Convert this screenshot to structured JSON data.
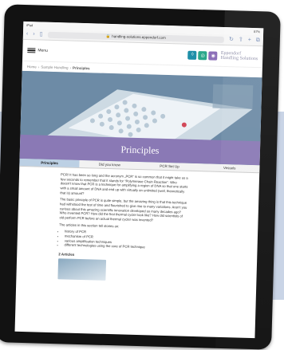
{
  "status": {
    "left": "iPad",
    "right": "87%"
  },
  "browser": {
    "url": "handling-solutions.eppendorf.com"
  },
  "header": {
    "menu_label": "Menu",
    "logo_line1": "Eppendorf",
    "logo_line2": "Handling Solutions"
  },
  "breadcrumb": {
    "home": "Home",
    "sep1": "›",
    "sample": "Sample Handling",
    "sep2": "›",
    "current": "Principles"
  },
  "hero": {
    "title": "Principles"
  },
  "tabs": [
    {
      "label": "Principles"
    },
    {
      "label": "Did you know"
    },
    {
      "label": "PCR Set Up"
    },
    {
      "label": "Vessels"
    }
  ],
  "content": {
    "p1": "PCR! It has been so long and the acronym „PCR“ is so common that it might take us a few seconds to remember that it stands for “Polymerase Chain Reaction”. Who doesn’t know that PCR is a technique for amplifying a region of DNA so that one starts with a small amount of DNA and end up with virtually an unlimited (well, theoretically that is) amount?",
    "p2": "The basic principle of PCR is quite simple, but the amazing thing is that this technique had withstood the test of time and flourished to give rise to many variations. Aren’t you curious about this amazing scientific innovation developed so many decades ago? Who invented PCR? How did the first thermal cycler look like? How did scientists of old perform PCR before an actual thermal cycler was invented?",
    "p3": "The articles in this section tell stories on:",
    "list": [
      "history of PCR",
      "mechanism of PCR",
      "various amplification techniques",
      "different technologies using the core of PCR technique"
    ],
    "articles_title": "2 Articles"
  },
  "colors": {
    "app1": "#1e8fa8",
    "app2": "#2aa78a",
    "app3": "#8c6fb8",
    "hero_band": "#8a79b5",
    "tab_active": "#bcd0e4"
  }
}
